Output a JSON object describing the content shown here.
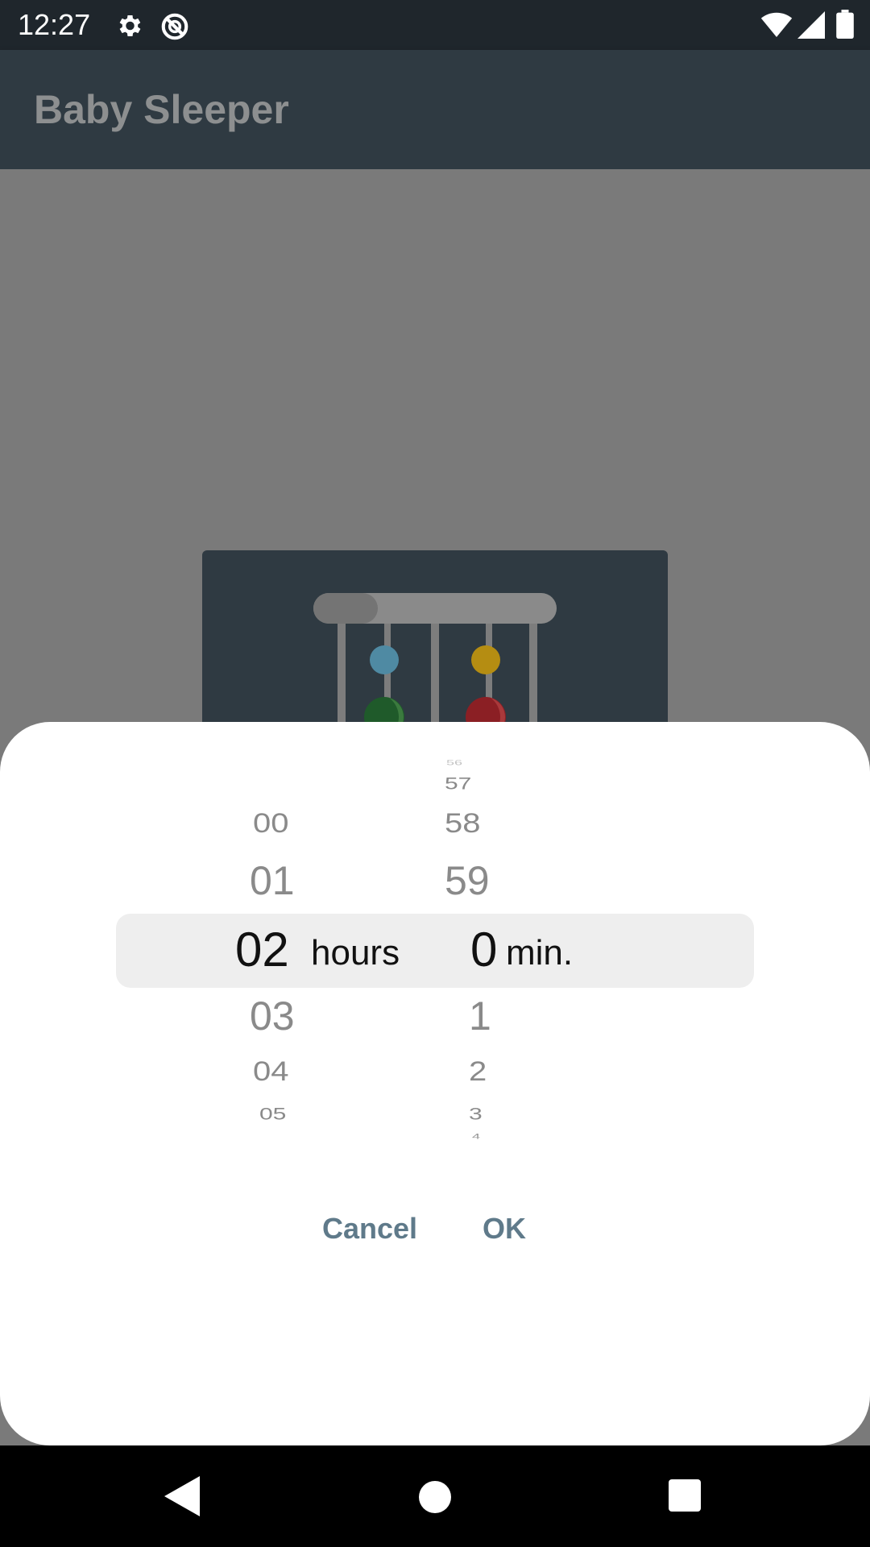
{
  "status_bar": {
    "time": "12:27",
    "icons": [
      "gear-icon",
      "data-saver-icon",
      "wifi-icon",
      "signal-icon",
      "battery-icon"
    ]
  },
  "app_bar": {
    "title": "Baby Sleeper"
  },
  "content": {
    "image": "baby-mobile-illustration"
  },
  "picker": {
    "hours": {
      "above": [
        "00",
        "01"
      ],
      "selected": "02",
      "below": [
        "03",
        "04",
        "05"
      ],
      "unit": "hours"
    },
    "minutes": {
      "above": [
        "56",
        "57",
        "58",
        "59"
      ],
      "selected": "0",
      "below": [
        "1",
        "2",
        "3",
        "4"
      ],
      "unit": "min."
    }
  },
  "buttons": {
    "cancel": "Cancel",
    "ok": "OK"
  },
  "nav_bar": {
    "icons": [
      "back-icon",
      "home-icon",
      "recents-icon"
    ]
  },
  "colors": {
    "status_bar": "#1f262c",
    "app_bar": "#2f3a42",
    "scrim_background": "#7a7a7a",
    "dialog_background": "#ffffff",
    "selection_band": "#eeeeee",
    "button_text": "#5f7a8a"
  }
}
